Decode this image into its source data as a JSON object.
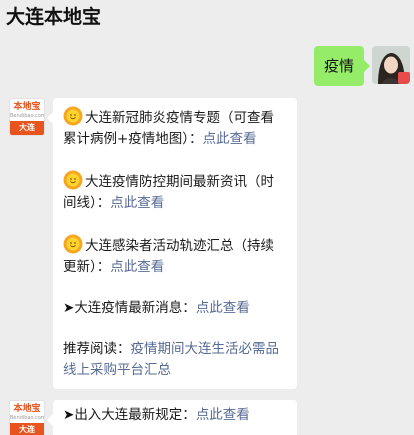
{
  "window": {
    "title": "大连本地宝"
  },
  "user_message": {
    "text": "疫情"
  },
  "bot": {
    "logo_top": "本地宝",
    "logo_mid": "Bendibao.com",
    "logo_bottom": "大连"
  },
  "reply": {
    "items": [
      {
        "icon": "sun-icon",
        "text": "大连新冠肺炎疫情专题（可查看累计病例+疫情地图）：",
        "link": "点此查看"
      },
      {
        "icon": "sun-icon",
        "text": "大连疫情防控期间最新资讯（时间线）：",
        "link": "点此查看"
      },
      {
        "icon": "sun-icon",
        "text": "大连感染者活动轨迹汇总（持续更新）：",
        "link": "点此查看"
      },
      {
        "prefix": "➤",
        "text": "大连疫情最新消息：",
        "link": "点此查看"
      },
      {
        "text": "推荐阅读：",
        "link": "疫情期间大连生活必需品线上采购平台汇总"
      }
    ]
  },
  "reply2": {
    "prefix": "➤",
    "text": "出入大连最新规定：",
    "link": "点此查看"
  },
  "colors": {
    "background": "#ededed",
    "sent_bubble": "#95ec69",
    "link": "#576b95",
    "brand": "#e8541e"
  }
}
